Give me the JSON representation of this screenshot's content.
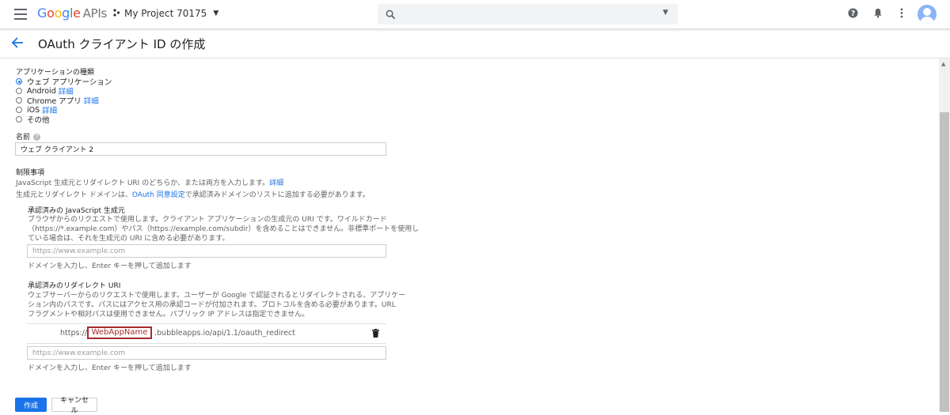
{
  "header": {
    "logo_google": "Google",
    "logo_apis": "APIs",
    "project_name": "My Project 70175"
  },
  "page": {
    "title": "OAuth クライアント ID の作成"
  },
  "app_type": {
    "label": "アプリケーションの種類",
    "options": [
      {
        "label": "ウェブ アプリケーション",
        "link": "",
        "checked": true
      },
      {
        "label": "Android",
        "link": "詳細",
        "checked": false
      },
      {
        "label": "Chrome アプリ",
        "link": "詳細",
        "checked": false
      },
      {
        "label": "iOS",
        "link": "詳細",
        "checked": false
      },
      {
        "label": "その他",
        "link": "",
        "checked": false
      }
    ]
  },
  "name_field": {
    "label": "名前",
    "value": "ウェブ クライアント 2"
  },
  "restrictions": {
    "heading": "制限事項",
    "desc1": "JavaScript 生成元とリダイレクト URI のどちらか、または両方を入力します。",
    "desc1_link": "詳細",
    "desc2_pre": "生成元とリダイレクト ドメインは、",
    "desc2_link": "OAuth 同意設定",
    "desc2_post": "で承認済みドメインのリストに追加する必要があります。"
  },
  "js_origins": {
    "heading": "承認済みの JavaScript 生成元",
    "desc_line1": "ブラウザからのリクエストで使用します。クライアント アプリケーションの生成元の URI です。ワイルドカード",
    "desc_line2": "（https://*.example.com）やパス（https://example.com/subdir）を含めることはできません。非標準ポートを使用し",
    "desc_line3": "ている場合は、それを生成元の URI に含める必要があります。",
    "placeholder": "https://www.example.com",
    "hint": "ドメインを入力し、Enter キーを押して追加します"
  },
  "redirect_uris": {
    "heading": "承認済みのリダイレクト URI",
    "desc_line1": "ウェブサーバーからのリクエストで使用します。ユーザーが Google で認証されるとリダイレクトされる、アプリケー",
    "desc_line2": "ション内のパスです。パスにはアクセス用の承認コードが付加されます。プロトコルを含める必要があります。URL",
    "desc_line3": "フラグメントや相対パスは使用できません。パブリック IP アドレスは指定できません。",
    "entry_prefix": "https://",
    "entry_highlight": "WebAppName",
    "entry_suffix": ".bubbleapps.io/api/1.1/oauth_redirect",
    "placeholder": "https://www.example.com",
    "hint": "ドメインを入力し、Enter キーを押して追加します"
  },
  "actions": {
    "create": "作成",
    "cancel": "キャンセル"
  },
  "colors": {
    "accent": "#1a73e8",
    "highlight": "#a52a2a"
  }
}
